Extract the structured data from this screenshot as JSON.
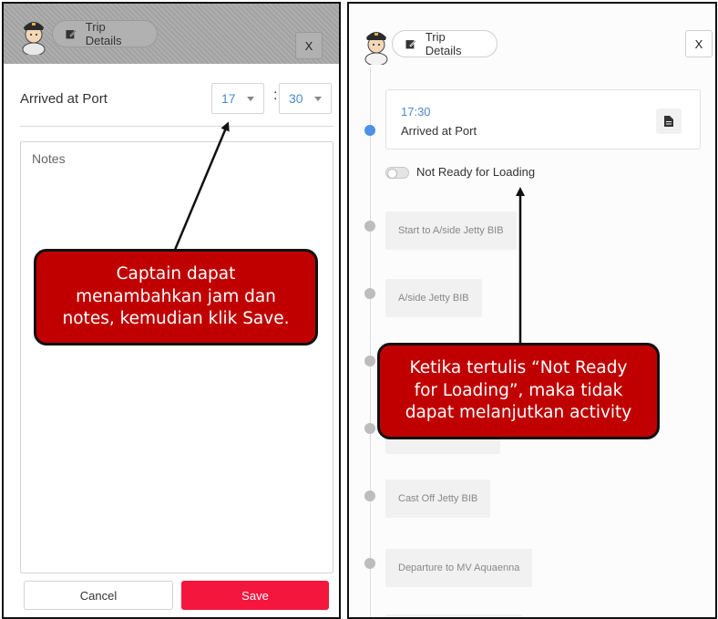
{
  "left_panel": {
    "header": {
      "trip_label": "Trip Details",
      "close_label": "X"
    },
    "event_label": "Arrived at Port",
    "hour_value": "17",
    "minute_value": "30",
    "time_separator": ":",
    "notes_placeholder": "Notes",
    "cancel_label": "Cancel",
    "save_label": "Save"
  },
  "right_panel": {
    "header": {
      "trip_label": "Trip Details",
      "close_label": "X"
    },
    "active_event": {
      "time": "17:30",
      "title": "Arrived at Port"
    },
    "toggle_label": "Not Ready for Loading",
    "steps": [
      "Start to A/side Jetty BIB",
      "A/side Jetty BIB",
      "Cast Off Jetty BIB",
      "Departure to MV Aquaenna"
    ]
  },
  "callouts": {
    "left": "Captain dapat\nmenambahkan jam dan\nnotes, kemudian klik Save.",
    "right": "Ketika tertulis “Not Ready\nfor Loading”, maka tidak\ndapat melanjutkan activity"
  },
  "icons": [
    "captain-avatar-icon",
    "edit-icon",
    "document-icon",
    "arrow"
  ],
  "colors": {
    "save": "#f4163c",
    "callout": "#c00000",
    "accent_time": "#4a8ad4",
    "active_dot": "#4b91e6"
  }
}
